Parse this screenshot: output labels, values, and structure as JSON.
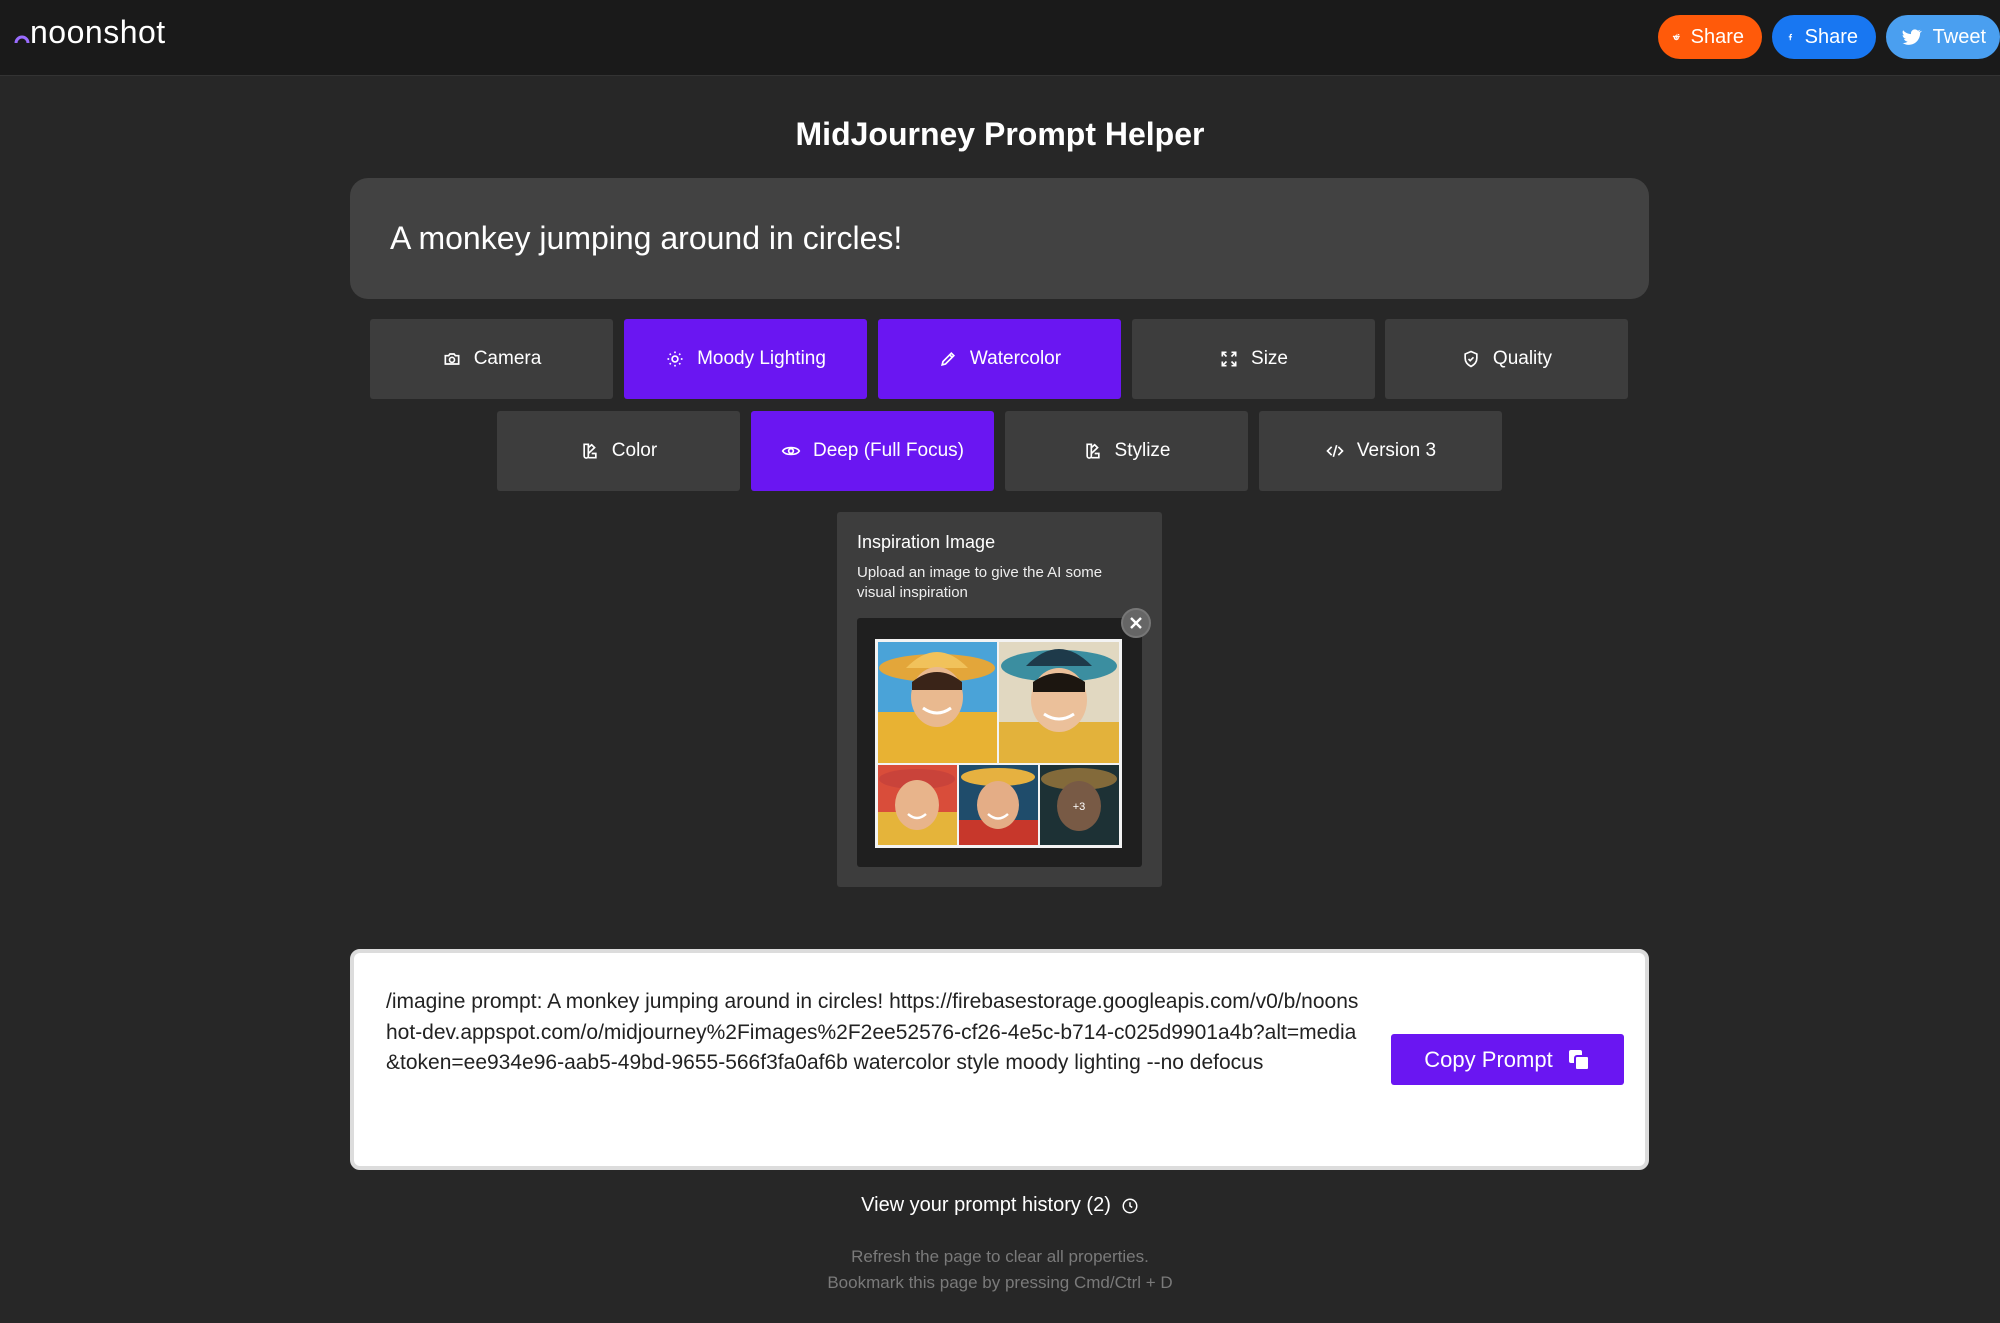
{
  "header": {
    "logo_text": "noonshot",
    "share_buttons": [
      {
        "label": "Share",
        "icon": "reddit-icon",
        "color": "#ff5a0a"
      },
      {
        "label": "Share",
        "icon": "facebook-icon",
        "color": "#1877f2"
      },
      {
        "label": "Tweet",
        "icon": "twitter-icon",
        "color": "#4a9ff0"
      }
    ]
  },
  "main": {
    "title": "MidJourney Prompt Helper",
    "prompt_text": "A monkey jumping around in circles!",
    "options_row1": [
      {
        "label": "Camera",
        "icon": "camera-icon",
        "active": false
      },
      {
        "label": "Moody Lighting",
        "icon": "lightbulb-icon",
        "active": true
      },
      {
        "label": "Watercolor",
        "icon": "pencil-icon",
        "active": true
      },
      {
        "label": "Size",
        "icon": "expand-icon",
        "active": false
      },
      {
        "label": "Quality",
        "icon": "shield-check-icon",
        "active": false
      }
    ],
    "options_row2": [
      {
        "label": "Color",
        "icon": "palette-icon",
        "active": false
      },
      {
        "label": "Deep (Full Focus)",
        "icon": "eye-icon",
        "active": true
      },
      {
        "label": "Stylize",
        "icon": "palette-icon",
        "active": false
      },
      {
        "label": "Version 3",
        "icon": "code-icon",
        "active": false
      }
    ],
    "inspiration": {
      "title": "Inspiration Image",
      "subtitle": "Upload an image to give the AI some visual inspiration",
      "extra_count_label": "+3"
    },
    "output": {
      "text": "/imagine prompt: A monkey jumping around in circles! https://firebasestorage.googleapis.com/v0/b/noonshot-dev.appspot.com/o/midjourney%2Fimages%2F2ee52576-cf26-4e5c-b714-c025d9901a4b?alt=media&token=ee934e96-aab5-49bd-9655-566f3fa0af6b watercolor style moody lighting --no defocus",
      "copy_label": "Copy Prompt"
    },
    "history_label": "View your prompt history (2)",
    "footer_lines": [
      "Refresh the page to clear all properties.",
      "Bookmark this page by pressing Cmd/Ctrl + D"
    ]
  },
  "colors": {
    "accent": "#6a16f2",
    "background": "#272727",
    "panel": "#3d3d3d"
  }
}
